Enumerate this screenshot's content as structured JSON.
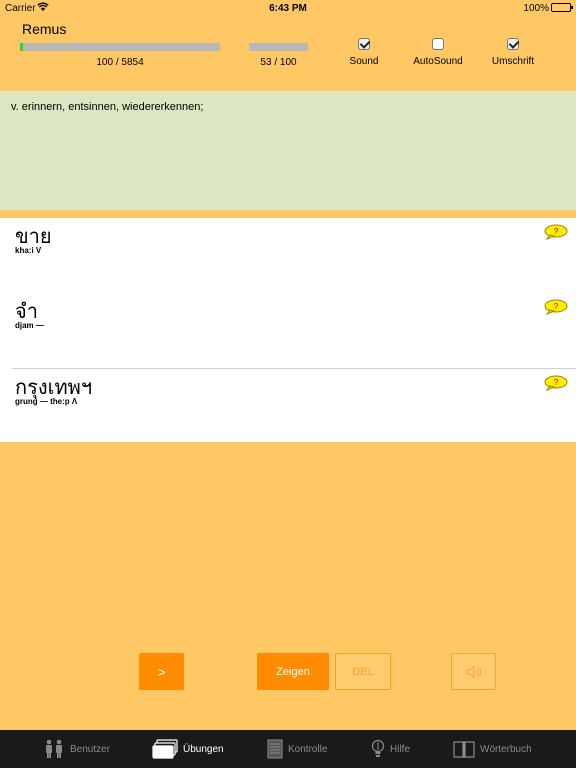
{
  "status_bar": {
    "carrier": "Carrier",
    "time": "6:43 PM",
    "battery": "100%"
  },
  "header": {
    "user_name": "Remus",
    "progress_total": {
      "label": "100 / 5854",
      "fraction": 0.017
    },
    "progress_session": {
      "label": "53 / 100",
      "fraction": 0.0
    },
    "options": [
      {
        "label": "Sound",
        "checked": true
      },
      {
        "label": "AutoSound",
        "checked": false
      },
      {
        "label": "Umschrift",
        "checked": true
      }
    ]
  },
  "meaning": {
    "text": "v. erinnern, entsinnen, wiedererkennen;"
  },
  "cards": [
    {
      "thai": "ขาย",
      "translit": "kha:i V"
    },
    {
      "thai": "จำ",
      "translit": "djam —"
    },
    {
      "thai": "กรุงเทพฯ",
      "translit": "grung — the:p Λ"
    }
  ],
  "controls": {
    "next": ">",
    "show": "Zeigen",
    "delete": "DEL",
    "speaker_icon": "speaker-icon"
  },
  "tabs": [
    {
      "label": "Benutzer",
      "icon": "users-icon",
      "active": false
    },
    {
      "label": "Übungen",
      "icon": "cards-icon",
      "active": true
    },
    {
      "label": "Kontrolle",
      "icon": "notepad-icon",
      "active": false
    },
    {
      "label": "Hilfe",
      "icon": "lightbulb-icon",
      "active": false
    },
    {
      "label": "Wörterbuch",
      "icon": "book-icon",
      "active": false
    }
  ],
  "colors": {
    "background": "#ffc864",
    "accent": "#ff8c00",
    "meaning_panel": "#dbe7c3",
    "progress": "#39d22a",
    "tab_bar": "#1a1a1a"
  }
}
